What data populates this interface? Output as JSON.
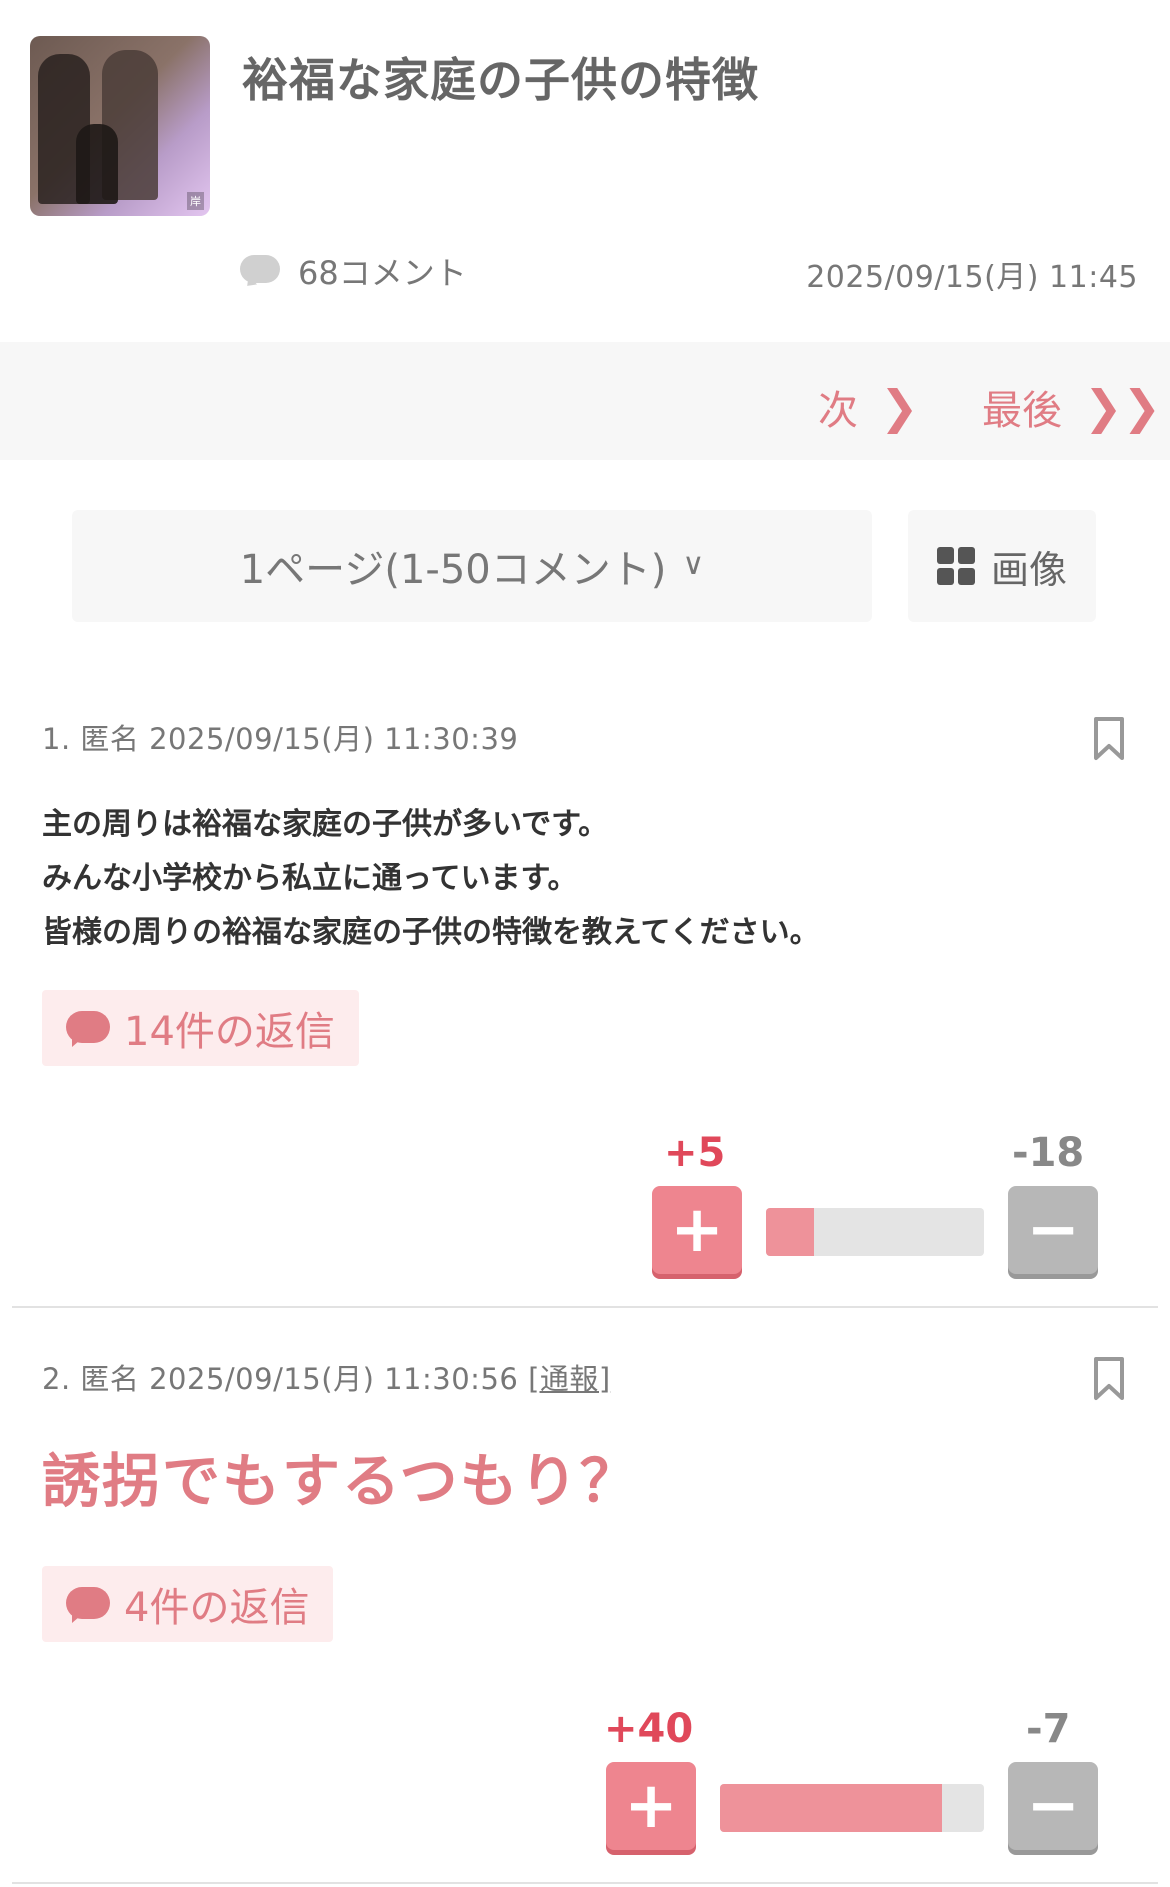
{
  "topic": {
    "title": "裕福な家庭の子供の特徴",
    "comment_count": "68コメント",
    "date": "2025/09/15(月) 11:45",
    "thumbnail_caption": "岸"
  },
  "pager": {
    "next_label": "次",
    "last_label": "最後"
  },
  "page_select": {
    "label": "1ページ(1-50コメント)",
    "image_label": "画像"
  },
  "comments": [
    {
      "meta": "1. 匿名 2025/09/15(月) 11:30:39",
      "lines": [
        "主の周りは裕福な家庭の子供が多いです。",
        "みんな小学校から私立に通っています。",
        "皆様の周りの裕福な家庭の子供の特徴を教えてください。"
      ],
      "reply_label": "14件の返信",
      "plus": "+5",
      "minus": "-18",
      "plus_ratio": 0.22
    },
    {
      "meta": "2. 匿名 2025/09/15(月) 11:30:56",
      "report": "[通報]",
      "text": "誘拐でもするつもり？",
      "reply_label": "4件の返信",
      "plus": "+40",
      "minus": "-7",
      "plus_ratio": 0.84
    }
  ],
  "colors": {
    "accent": "#e07c84",
    "plus": "#ee858f",
    "minus": "#b7b7b7"
  }
}
